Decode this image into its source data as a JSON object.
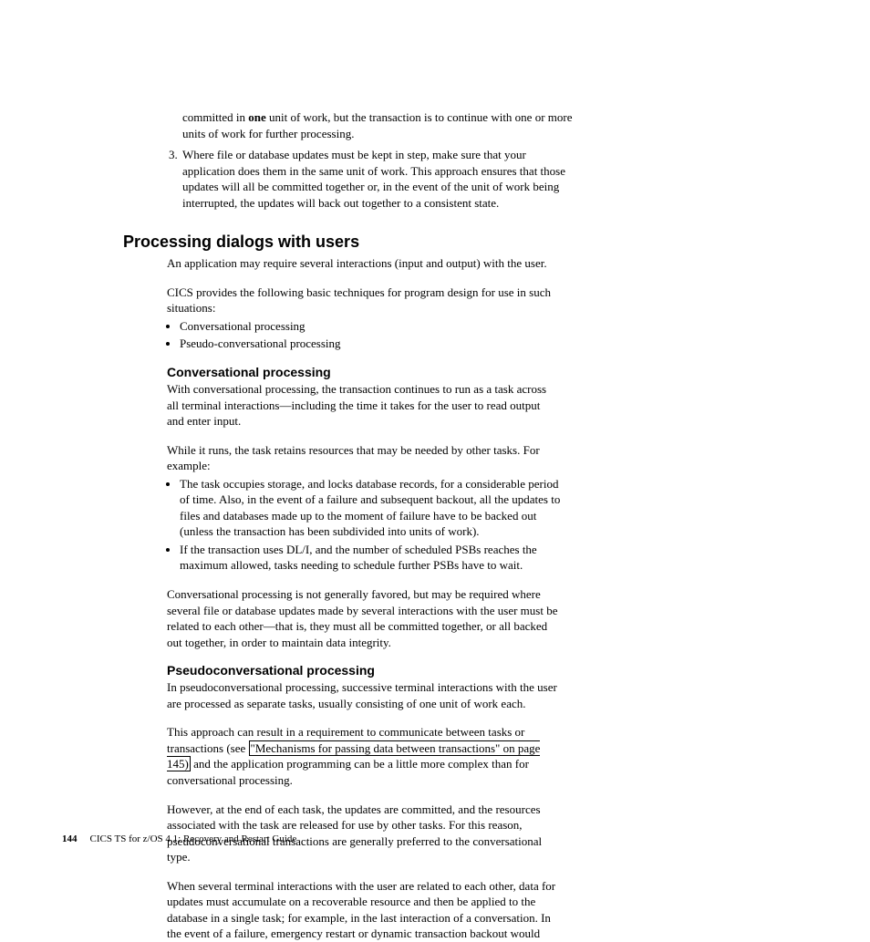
{
  "intro": {
    "line1_pre": "committed in ",
    "bold": "one",
    "line1_post": " unit of work, but the transaction is to continue with one or more units of work for further processing."
  },
  "item3": {
    "num": "3.",
    "text": "Where file or database updates must be kept in step, make sure that your application does them in the same unit of work. This approach ensures that those updates will all be committed together or, in the event of the unit of work being interrupted, the updates will back out together to a consistent state."
  },
  "h1": "Processing dialogs with users",
  "p1": "An application may require several interactions (input and output) with the user.",
  "p2": "CICS provides the following basic techniques for program design for use in such situations:",
  "list1": {
    "a": "Conversational processing",
    "b": "Pseudo-conversational processing"
  },
  "h2a": "Conversational processing",
  "conv_p1": "With conversational processing, the transaction continues to run as a task across all terminal interactions—including the time it takes for the user to read output and enter input.",
  "conv_p2": "While it runs, the task retains resources that may be needed by other tasks. For example:",
  "conv_list": {
    "a": "The task occupies storage, and locks database records, for a considerable period of time. Also, in the event of a failure and subsequent backout, all the updates to files and databases made up to the moment of failure have to be backed out (unless the transaction has been subdivided into units of work).",
    "b": "If the transaction uses DL/I, and the number of scheduled PSBs reaches the maximum allowed, tasks needing to schedule further PSBs have to wait."
  },
  "conv_p3": "Conversational processing is not generally favored, but may be required where several file or database updates made by several interactions with the user must be related to each other—that is, they must all be committed together, or all backed out together, in order to maintain data integrity.",
  "h2b": "Pseudoconversational processing",
  "ps_p1": "In pseudoconversational processing, successive terminal interactions with the user are processed as separate tasks, usually consisting of one unit of work each.",
  "ps_p2_pre": "This approach can result in a requirement to communicate between tasks or transactions (see ",
  "ps_link": "\"Mechanisms for passing data between transactions\" on page 145)",
  "ps_p2_post": " and the application programming can be a little more complex than for conversational processing.",
  "ps_p3": "However, at the end of each task, the updates are committed, and the resources associated with the task are released for use by other tasks. For this reason, pseudoconversational transactions are generally preferred to the conversational type.",
  "ps_p4": "When several terminal interactions with the user are related to each other, data for updates must accumulate on a recoverable resource and then be applied to the database in a single task; for example, in the last interaction of a conversation. In the event of a failure, emergency restart or dynamic transaction backout would",
  "footer": {
    "page": "144",
    "title": "CICS TS for z/OS 4.1: Recovery and Restart Guide"
  }
}
